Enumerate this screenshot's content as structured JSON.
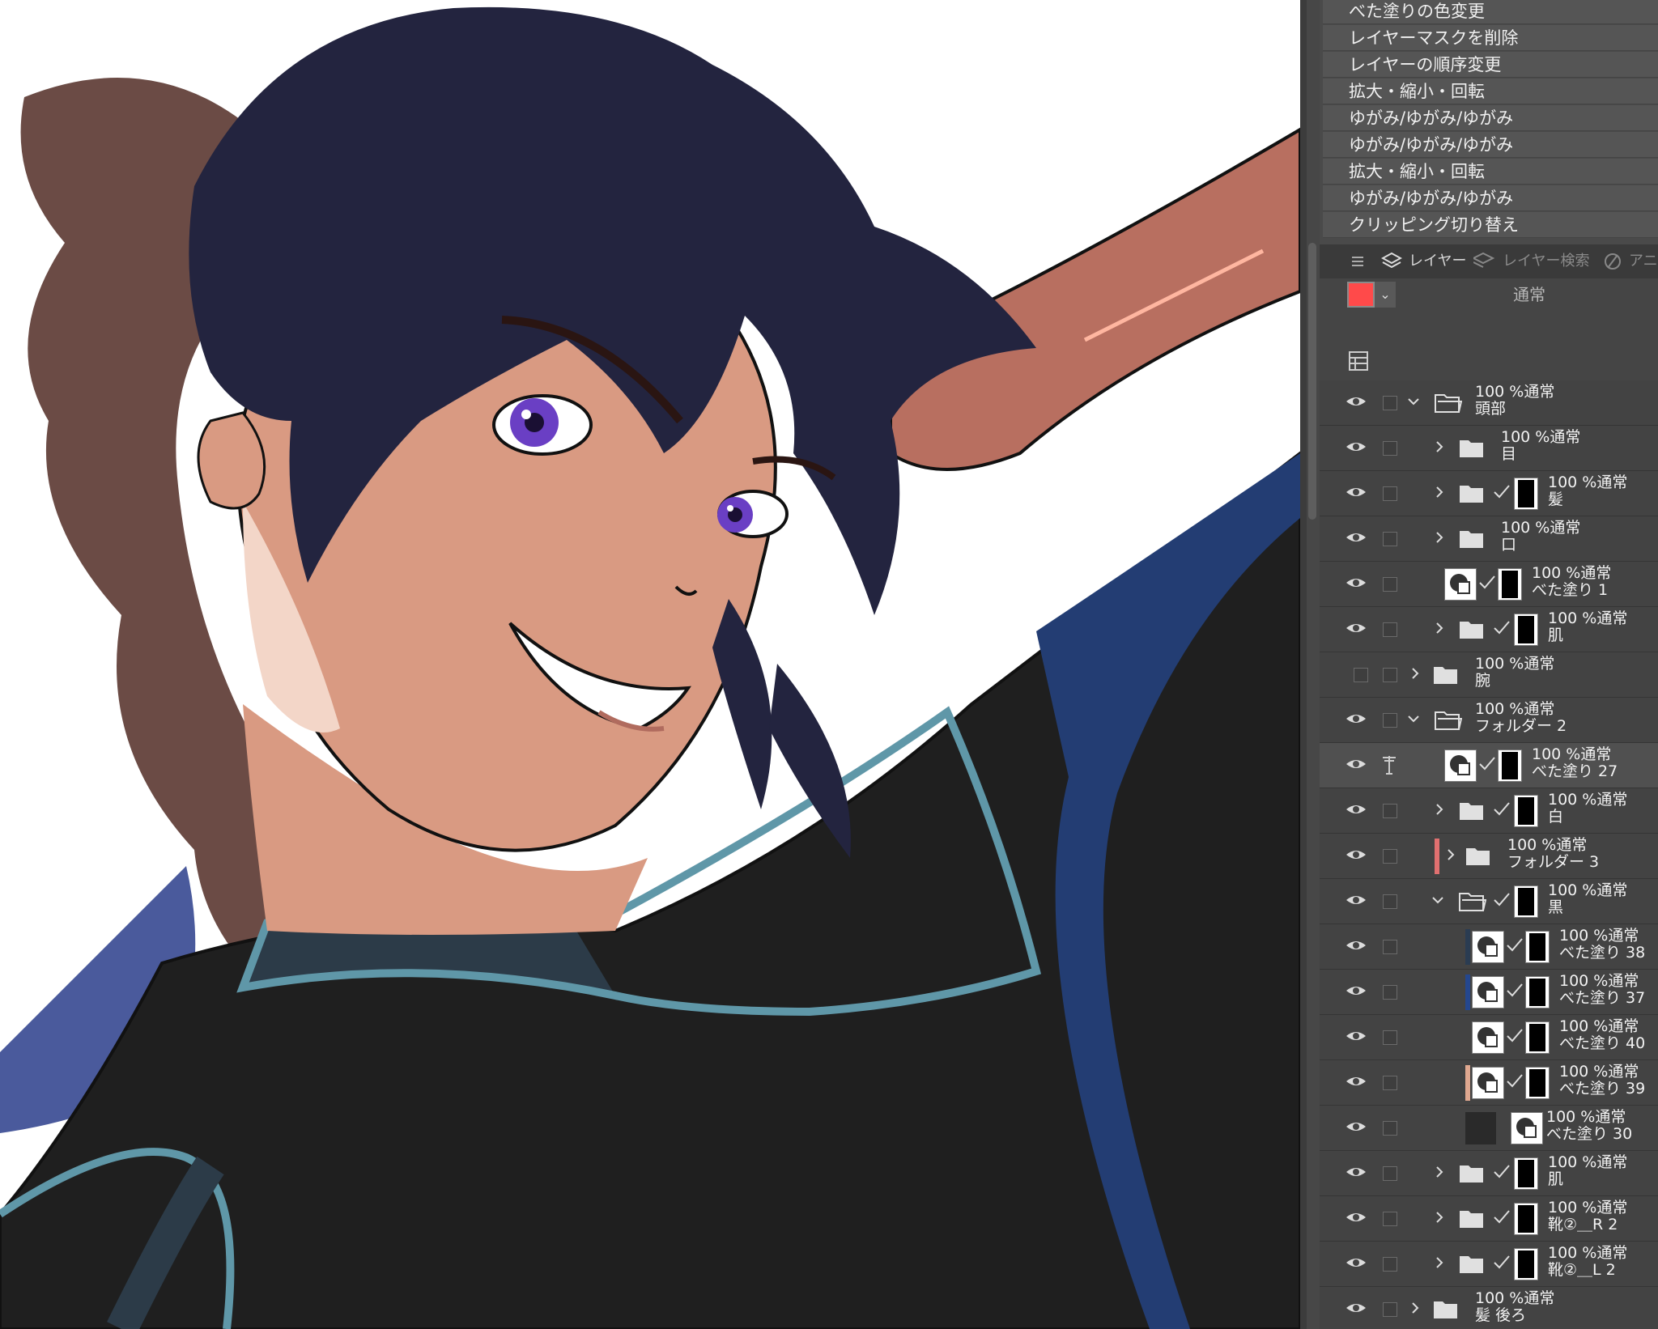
{
  "history": {
    "items": [
      "べた塗りの色変更",
      "レイヤーマスクを削除",
      "レイヤーの順序変更",
      "拡大・縮小・回転",
      "ゆがみ/ゆがみ/ゆがみ",
      "ゆがみ/ゆがみ/ゆがみ",
      "拡大・縮小・回転",
      "ゆがみ/ゆがみ/ゆがみ",
      "クリッピング切り替え"
    ]
  },
  "tabs": {
    "menu_icon": "menu-icon",
    "layer": "レイヤー",
    "layer_search": "レイヤー検索",
    "animation": "アニ"
  },
  "blend": {
    "color": "#ff4a4a",
    "mode": "通常",
    "dropdown": "⌄"
  },
  "layers": [
    {
      "opacity": "100 %通常",
      "name": "頭部"
    },
    {
      "opacity": "100 %通常",
      "name": "目"
    },
    {
      "opacity": "100 %通常",
      "name": "髪"
    },
    {
      "opacity": "100 %通常",
      "name": "口"
    },
    {
      "opacity": "100 %通常",
      "name": "べた塗り 1"
    },
    {
      "opacity": "100 %通常",
      "name": "肌"
    },
    {
      "opacity": "100 %通常",
      "name": "腕"
    },
    {
      "opacity": "100 %通常",
      "name": "フォルダー 2"
    },
    {
      "opacity": "100 %通常",
      "name": "べた塗り 27"
    },
    {
      "opacity": "100 %通常",
      "name": "白"
    },
    {
      "opacity": "100 %通常",
      "name": "フォルダー 3"
    },
    {
      "opacity": "100 %通常",
      "name": "黒"
    },
    {
      "opacity": "100 %通常",
      "name": "べた塗り 38"
    },
    {
      "opacity": "100 %通常",
      "name": "べた塗り 37"
    },
    {
      "opacity": "100 %通常",
      "name": "べた塗り 40"
    },
    {
      "opacity": "100 %通常",
      "name": "べた塗り 39"
    },
    {
      "opacity": "100 %通常",
      "name": "べた塗り 30"
    },
    {
      "opacity": "100 %通常",
      "name": "肌"
    },
    {
      "opacity": "100 %通常",
      "name": "靴②＿R 2"
    },
    {
      "opacity": "100 %通常",
      "name": "靴②＿L 2"
    },
    {
      "opacity": "100 %通常",
      "name": "髪 後ろ"
    }
  ],
  "colors": {
    "panel": "#4a4a4a",
    "accent_swatch": "#ff4a4a",
    "folder3_label": "#e07070"
  }
}
